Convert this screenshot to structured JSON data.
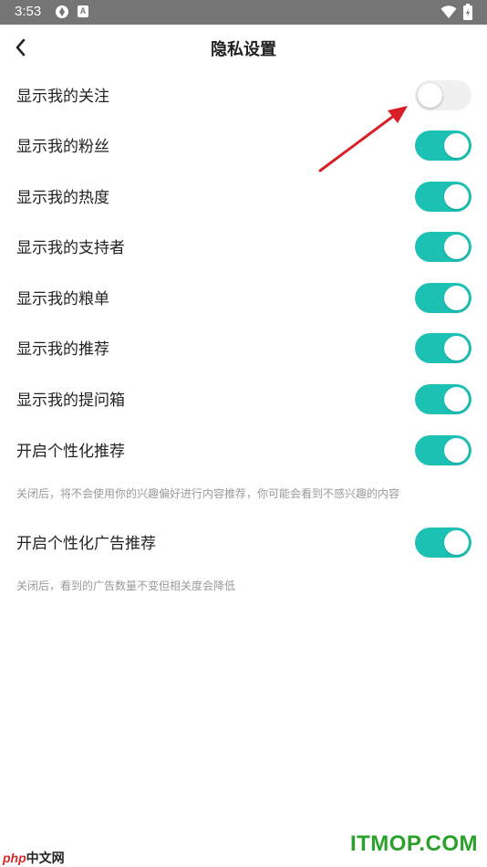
{
  "status_bar": {
    "time": "3:53",
    "icons": [
      "app-notification-icon",
      "a-badge-icon",
      "wifi-icon",
      "battery-charging-icon"
    ],
    "badge_letter": "A"
  },
  "header": {
    "title": "隐私设置",
    "back_icon": "chevron-left-icon"
  },
  "settings": [
    {
      "label": "显示我的关注",
      "enabled": false
    },
    {
      "label": "显示我的粉丝",
      "enabled": true
    },
    {
      "label": "显示我的热度",
      "enabled": true
    },
    {
      "label": "显示我的支持者",
      "enabled": true
    },
    {
      "label": "显示我的粮单",
      "enabled": true
    },
    {
      "label": "显示我的推荐",
      "enabled": true
    },
    {
      "label": "显示我的提问箱",
      "enabled": true
    },
    {
      "label": "开启个性化推荐",
      "enabled": true,
      "note": "关闭后，将不会使用你的兴趣偏好进行内容推荐，你可能会看到不感兴趣的内容"
    },
    {
      "label": "开启个性化广告推荐",
      "enabled": true,
      "note": "关闭后，看到的广告数量不变但相关度会降低"
    }
  ],
  "colors": {
    "toggle_on": "#1cc1b3",
    "toggle_off": "#f0f0f0",
    "arrow": "#d81f26",
    "status_bar": "#757575"
  },
  "watermarks": {
    "left_php": "php",
    "left_rest": "中文网",
    "right": "ITMOP.COM"
  }
}
